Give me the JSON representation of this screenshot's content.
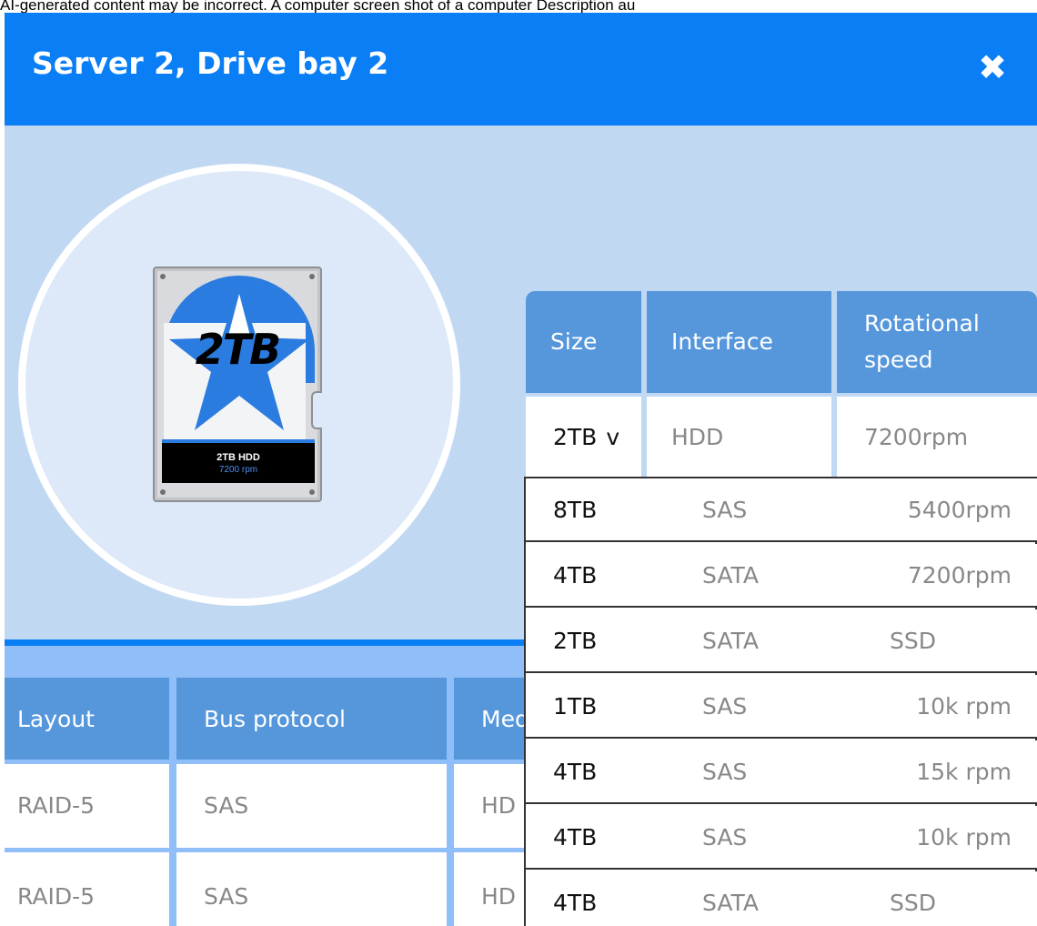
{
  "caption": "AI-generated content may be incorrect. A computer screen shot of a computer Description au",
  "dialog": {
    "title": "Server 2, Drive bay 2",
    "close_icon": "close-icon",
    "close_glyph": "✖",
    "accent": "#0a7ff5"
  },
  "drive": {
    "size_text": "2TB",
    "label_line1": "2TB HDD",
    "label_line2": "7200 rpm",
    "star_color": "#2b7ce0"
  },
  "spec_table": {
    "headers": {
      "size": "Size",
      "interface": "Interface",
      "rotational_speed": "Rotational speed"
    },
    "selected": {
      "size": "2TB",
      "chevron": "v",
      "interface": "HDD",
      "rotational_speed": "7200rpm"
    }
  },
  "dropdown": {
    "options": [
      {
        "size": "8TB",
        "interface": "SAS",
        "speed": "5400rpm"
      },
      {
        "size": "4TB",
        "interface": "SATA",
        "speed": "7200rpm"
      },
      {
        "size": "2TB",
        "interface": "SATA",
        "speed": "SSD"
      },
      {
        "size": "1TB",
        "interface": "SAS",
        "speed": "10k rpm"
      },
      {
        "size": "4TB",
        "interface": "SAS",
        "speed": "15k rpm"
      },
      {
        "size": "4TB",
        "interface": "SAS",
        "speed": "10k rpm"
      },
      {
        "size": "4TB",
        "interface": "SATA",
        "speed": "SSD"
      }
    ]
  },
  "layout_table": {
    "headers": {
      "layout": "Layout",
      "bus_protocol": "Bus protocol",
      "media": "Med"
    },
    "rows": [
      {
        "layout": "RAID-5",
        "bus_protocol": "SAS",
        "media": "HD"
      },
      {
        "layout": "RAID-5",
        "bus_protocol": "SAS",
        "media": "HD"
      }
    ]
  }
}
